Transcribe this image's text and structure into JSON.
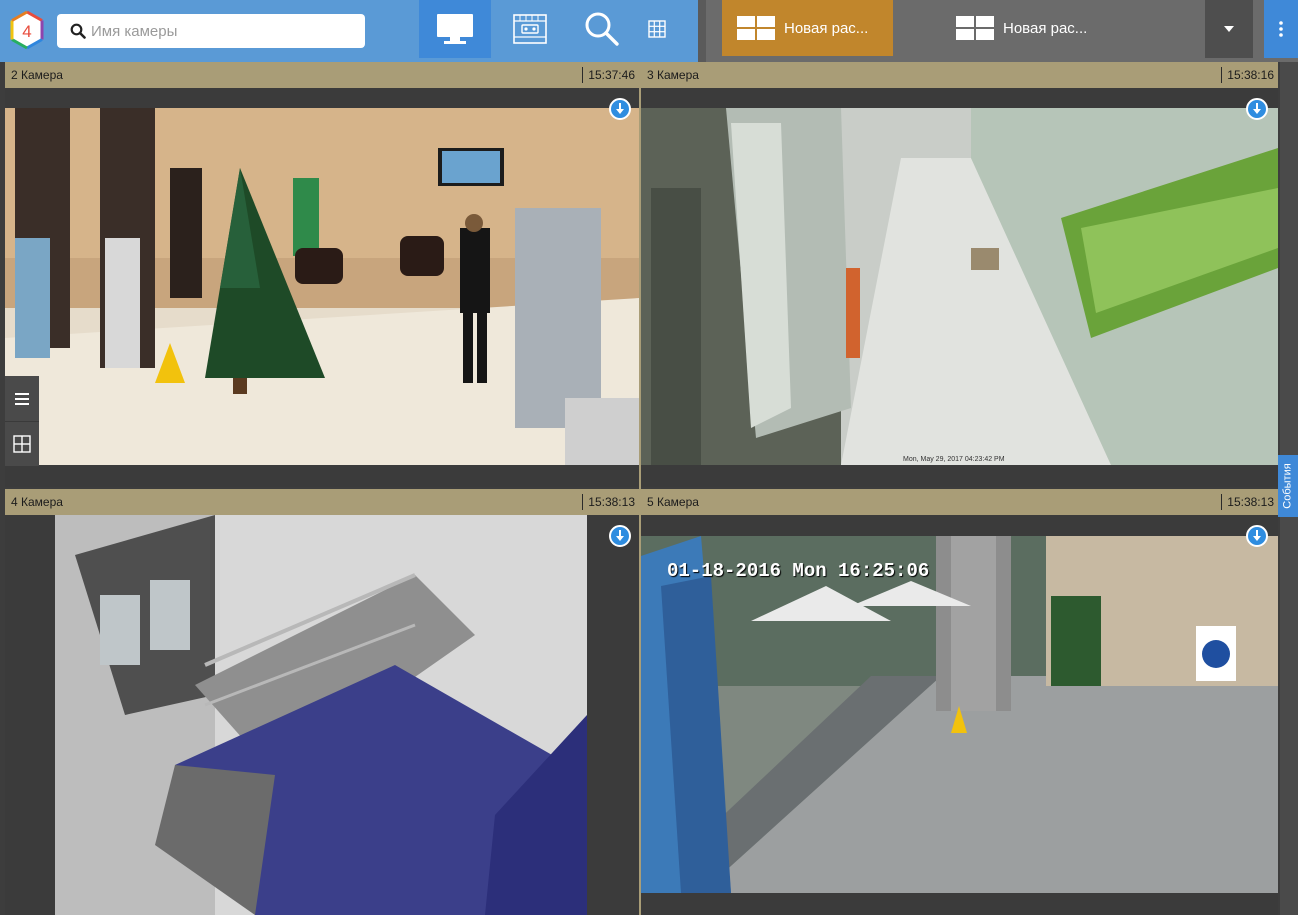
{
  "app": {
    "logo_label": "4"
  },
  "search": {
    "placeholder": "Имя камеры",
    "value": ""
  },
  "toolbar": {
    "live_icon": "monitor-icon",
    "archive_icon": "archive-tape-icon",
    "search_icon": "magnifier-icon",
    "grid_icon": "grid-icon"
  },
  "layouts": {
    "tabs": [
      {
        "label": "Новая рас...",
        "active": true
      },
      {
        "label": "Новая рас...",
        "active": false
      }
    ],
    "dropdown_icon": "caret-down-icon",
    "menu_icon": "kebab-menu-icon"
  },
  "colors": {
    "topbar_blue": "#5a9ad6",
    "active_blue": "#3f89d8",
    "active_layout": "#c1862c",
    "header_bar": "#a99d77",
    "download": "#2f8de0"
  },
  "cameras": [
    {
      "name": "2 Камера",
      "time": "15:37:46"
    },
    {
      "name": "3 Камера",
      "time": "15:38:16",
      "overlay": "Mon, May 29, 2017 04:23:42 PM"
    },
    {
      "name": "4 Камера",
      "time": "15:38:13"
    },
    {
      "name": "5 Камера",
      "time": "15:38:13",
      "overlay": "01-18-2016 Mon 16:25:06"
    }
  ],
  "side": {
    "menu_icon": "hamburger-icon",
    "layout_icon": "layout-grid-icon"
  },
  "events": {
    "label": "События"
  }
}
